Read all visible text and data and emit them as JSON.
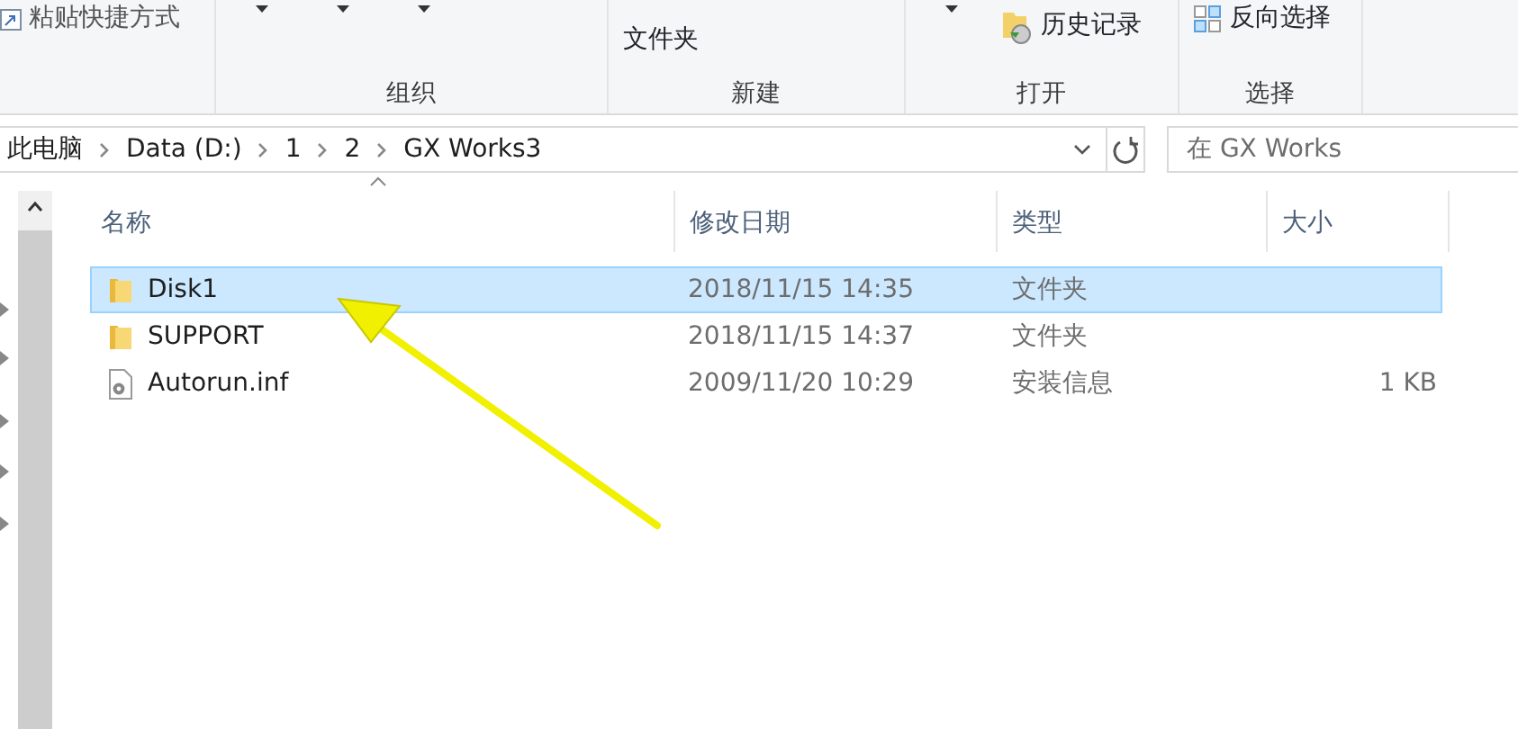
{
  "ribbon": {
    "groups": [
      {
        "items": [
          {
            "kind": "shortcut",
            "text": "粘贴快捷方式"
          }
        ]
      },
      {
        "label": "组织",
        "items": [
          {
            "kind": "caret"
          },
          {
            "kind": "caret"
          },
          {
            "kind": "caret"
          }
        ]
      },
      {
        "label": "新建",
        "items": [
          {
            "kind": "stack",
            "lines": [
              "文件夹"
            ]
          }
        ]
      },
      {
        "label": "打开",
        "items": [
          {
            "kind": "caret"
          },
          {
            "kind": "history",
            "text": "历史记录"
          }
        ]
      },
      {
        "label": "选择",
        "items": [
          {
            "kind": "invert",
            "text": "反向选择"
          }
        ]
      }
    ]
  },
  "address": {
    "crumbs": [
      "此电脑",
      "Data (D:)",
      "1",
      "2",
      "GX Works3"
    ],
    "search_placeholder": "在 GX Works"
  },
  "columns": [
    "名称",
    "修改日期",
    "类型",
    "大小"
  ],
  "files": [
    {
      "name": "Disk1",
      "modified": "2018/11/15 14:35",
      "type": "文件夹",
      "kind": "folder",
      "selected": true
    },
    {
      "name": "SUPPORT",
      "modified": "2018/11/15 14:37",
      "type": "文件夹",
      "kind": "folder",
      "selected": false
    },
    {
      "name": "Autorun.inf",
      "modified": "2009/11/20 10:29",
      "type": "安装信息",
      "size": "1 KB",
      "kind": "file",
      "selected": false
    }
  ]
}
